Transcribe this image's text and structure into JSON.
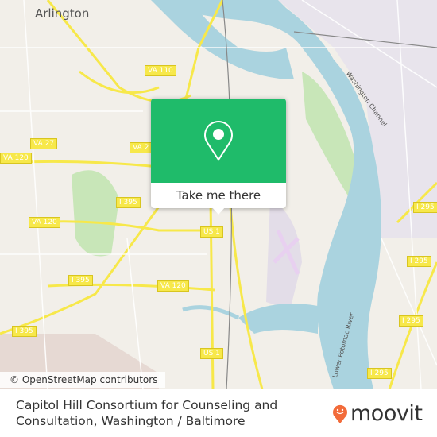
{
  "map": {
    "city_label": "Arlington",
    "shields": [
      {
        "label": "VA 110"
      },
      {
        "label": "VA 27"
      },
      {
        "label": "VA 120"
      },
      {
        "label": "VA 2"
      },
      {
        "label": "I 395"
      },
      {
        "label": "VA 120"
      },
      {
        "label": "I 395"
      },
      {
        "label": "VA 120"
      },
      {
        "label": "I 395"
      },
      {
        "label": "US 1"
      },
      {
        "label": "US 1"
      },
      {
        "label": "I 295"
      },
      {
        "label": "I 295"
      },
      {
        "label": "I 295"
      },
      {
        "label": "I 295"
      }
    ],
    "water_labels": [
      "Washington Channel",
      "Lower Potomac River"
    ],
    "attribution": "© OpenStreetMap contributors",
    "colors": {
      "water": "#aad3df",
      "park": "#c8e6b8",
      "land": "#f2efe9",
      "road": "#f7e84a"
    }
  },
  "popup": {
    "icon": "map-pin-icon",
    "button_label": "Take me there",
    "color": "#1fbb6a"
  },
  "footer": {
    "title": "Capitol Hill Consortium for Counseling and Consultation, Washington / Baltimore",
    "brand": "moovit",
    "brand_color": "#f26b3a"
  }
}
